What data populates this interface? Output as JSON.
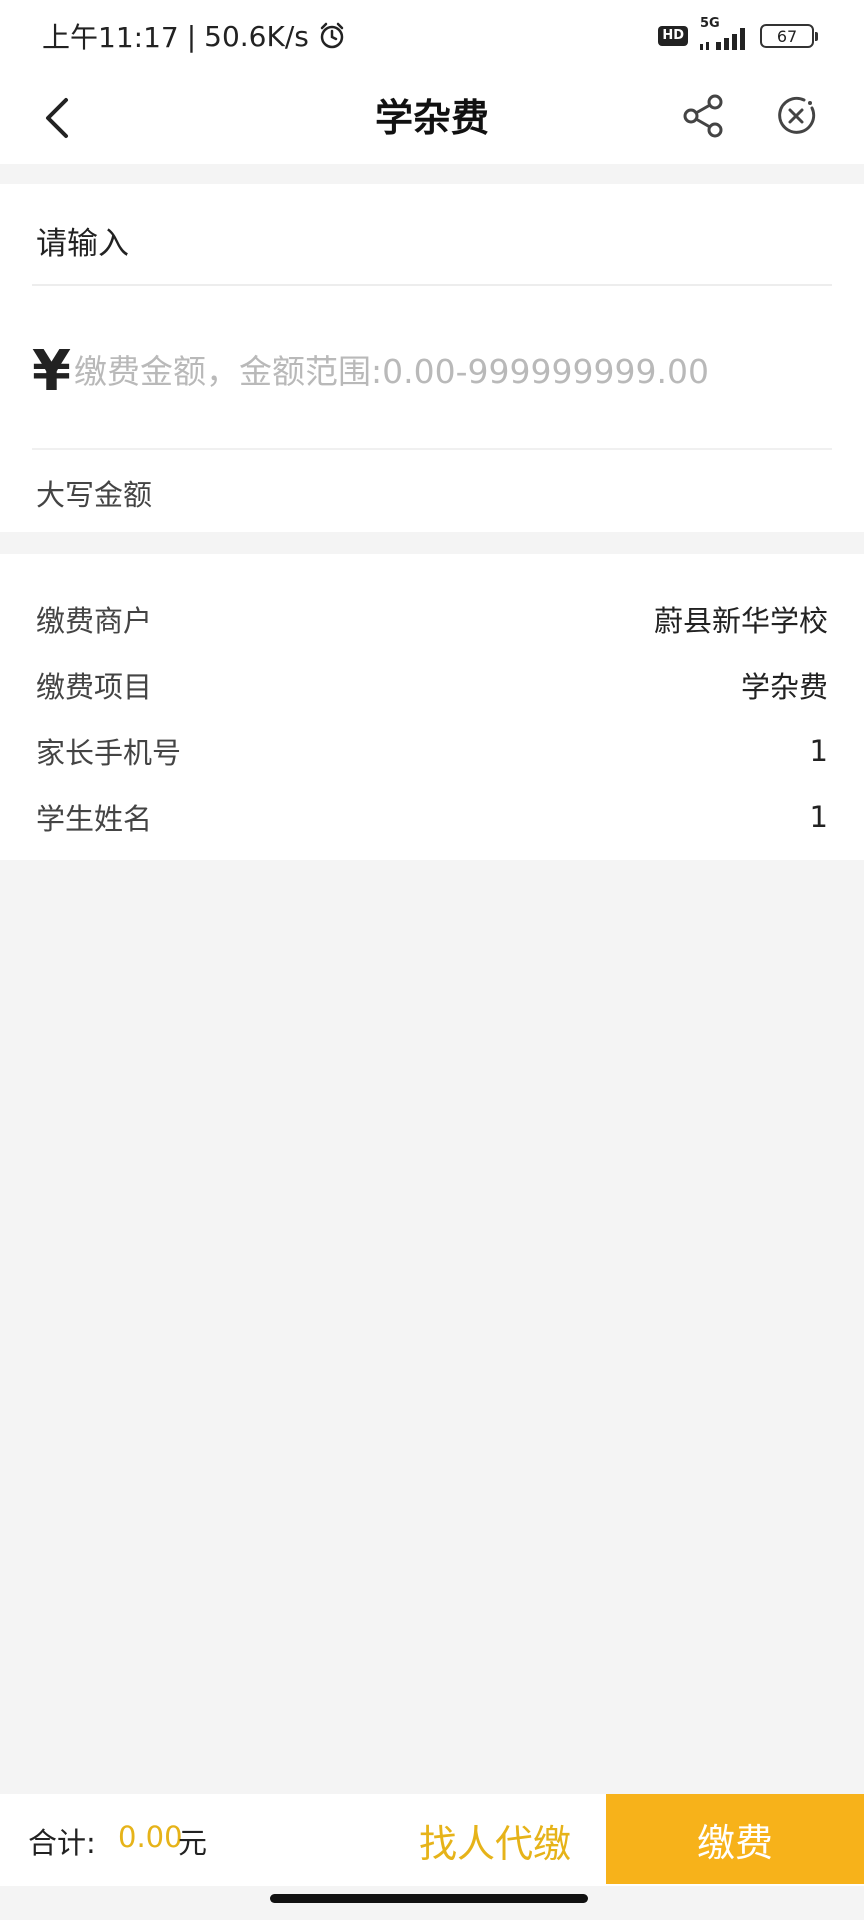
{
  "status_bar": {
    "time": "上午11:17",
    "separator": "|",
    "speed": "50.6K/s",
    "hd": "HD",
    "network": "5G",
    "battery": "67"
  },
  "header": {
    "title": "学杂费"
  },
  "input_card": {
    "label": "请输入",
    "currency": "¥",
    "amount_value": "",
    "amount_placeholder": "缴费金额，金额范围:0.00-999999999.00",
    "daxie_label": "大写金额"
  },
  "info": {
    "rows": [
      {
        "key": "缴费商户",
        "value": "蔚县新华学校"
      },
      {
        "key": "缴费项目",
        "value": "学杂费"
      },
      {
        "key": "家长手机号",
        "value": "1"
      },
      {
        "key": "学生姓名",
        "value": "1"
      }
    ]
  },
  "bottom_bar": {
    "total_label": "合计:",
    "total_amount": "0.00",
    "total_unit": "元",
    "proxy_label": "找人代缴",
    "pay_label": "缴费"
  },
  "colors": {
    "accent": "#f7b21a",
    "amount_text": "#e6b319",
    "background": "#f4f4f4"
  },
  "icons": [
    "alarm-icon",
    "hd-icon",
    "signal-icon",
    "battery-icon",
    "back-arrow-icon",
    "share-icon",
    "close-circle-icon"
  ]
}
